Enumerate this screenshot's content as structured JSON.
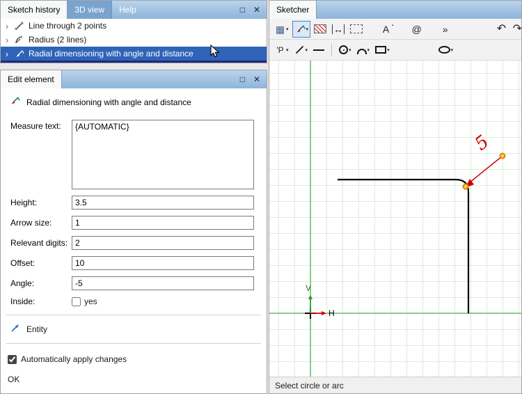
{
  "window_buttons": {
    "maximize": "□",
    "close": "✕"
  },
  "ui": {
    "caret": "▾",
    "chevron": "›"
  },
  "history_panel": {
    "tabs": [
      "Sketch history",
      "3D view",
      "Help"
    ],
    "items": [
      {
        "label": "Line through 2 points"
      },
      {
        "label": "Radius (2 lines)"
      },
      {
        "label": "Radial dimensioning with angle and distance"
      }
    ]
  },
  "edit_panel": {
    "tab": "Edit element",
    "tool_title": "Radial dimensioning with angle and distance",
    "measure_text": {
      "label": "Measure text:",
      "value": "{AUTOMATIC}"
    },
    "height": {
      "label": "Height:",
      "value": "3.5"
    },
    "arrow_size": {
      "label": "Arrow size:",
      "value": "1"
    },
    "relevant_digits": {
      "label": "Relevant digits:",
      "value": "2"
    },
    "offset": {
      "label": "Offset:",
      "value": "10"
    },
    "angle": {
      "label": "Angle:",
      "value": "-5"
    },
    "inside": {
      "label": "Inside:",
      "checkbox_label": "yes"
    },
    "entity_label": "Entity",
    "auto_apply": {
      "label": "Automatically apply changes",
      "checked": "checked"
    },
    "ok_label": "OK"
  },
  "sketcher": {
    "tab": "Sketcher",
    "status": "Select circle or arc",
    "dimension_text": "5",
    "axis_labels": {
      "h": "H",
      "v": "V"
    },
    "toolbar1": {
      "items": [
        {
          "name": "dimension-style-list",
          "glyph": "▦"
        },
        {
          "name": "radial-dimension-tool"
        },
        {
          "name": "hatch-tool"
        },
        {
          "name": "linear-dimension-tool",
          "glyph": "↔"
        },
        {
          "name": "selection-box-tool"
        },
        {
          "name": "text-annotation-tool",
          "glyph": "A",
          "badge": "▪"
        },
        {
          "name": "symbol-tool",
          "glyph": "@"
        },
        {
          "name": "overflow",
          "glyph": "»"
        },
        {
          "name": "undo",
          "glyph": "↶"
        },
        {
          "name": "redo",
          "glyph": "↷"
        }
      ]
    },
    "toolbar2": {
      "items": [
        {
          "name": "point-tool",
          "glyph": "'P"
        },
        {
          "name": "line-tool"
        },
        {
          "name": "polyline-tool"
        },
        {
          "name": "circle-tool"
        },
        {
          "name": "arc-tool"
        },
        {
          "name": "rectangle-tool"
        },
        {
          "name": "ellipse-tool"
        }
      ]
    }
  }
}
